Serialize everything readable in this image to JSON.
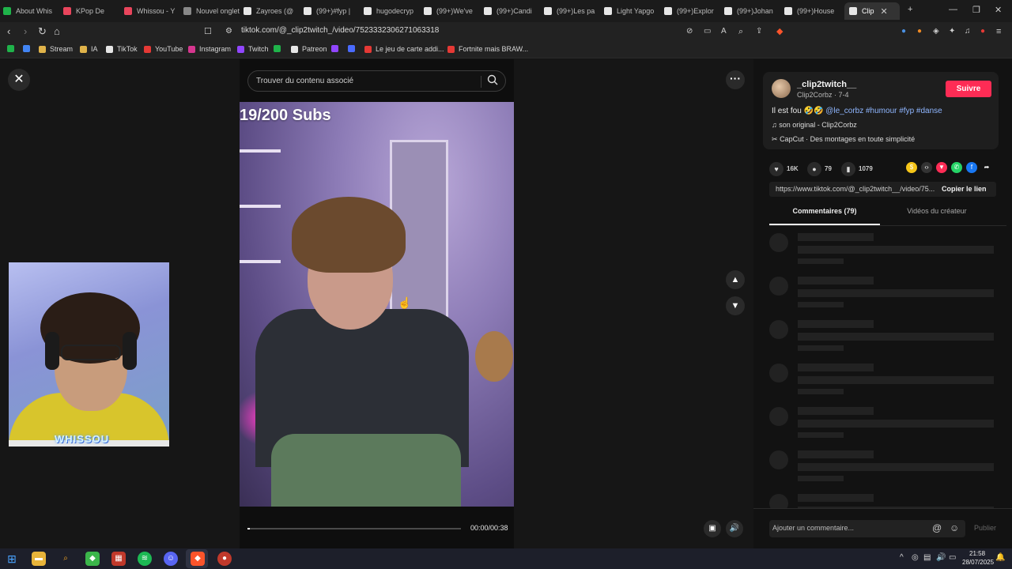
{
  "browser": {
    "tabs": [
      {
        "label": "About Whis",
        "color": "#1fb34a"
      },
      {
        "label": "KPop De",
        "color": "#e9455c"
      },
      {
        "label": "Whissou - Y",
        "color": "#e9455c"
      },
      {
        "label": "Nouvel onglet",
        "color": "#888888"
      },
      {
        "label": "Zayroes (@",
        "color": "#e6e6e6"
      },
      {
        "label": "(99+)#fyp |",
        "color": "#e6e6e6"
      },
      {
        "label": "hugodecryp",
        "color": "#e6e6e6"
      },
      {
        "label": "(99+)We've",
        "color": "#e6e6e6"
      },
      {
        "label": "(99+)Candi",
        "color": "#e6e6e6"
      },
      {
        "label": "(99+)Les pa",
        "color": "#e6e6e6"
      },
      {
        "label": "Light Yapgo",
        "color": "#e6e6e6"
      },
      {
        "label": "(99+)Explor",
        "color": "#e6e6e6"
      },
      {
        "label": "(99+)Johan",
        "color": "#e6e6e6"
      },
      {
        "label": "(99+)House",
        "color": "#e6e6e6"
      },
      {
        "label": "Clip",
        "color": "#e6e6e6"
      }
    ],
    "url": "tiktok.com/@_clip2twitch_/video/7523332306271063318",
    "bookmarks": [
      {
        "label": "",
        "color": "#1fb34a"
      },
      {
        "label": "",
        "color": "#4285f4"
      },
      {
        "label": "Stream",
        "color": "#e0b34a"
      },
      {
        "label": "IA",
        "color": "#e0b34a"
      },
      {
        "label": "TikTok",
        "color": "#e6e6e6"
      },
      {
        "label": "YouTube",
        "color": "#e53935"
      },
      {
        "label": "Instagram",
        "color": "#d6368f"
      },
      {
        "label": "Twitch",
        "color": "#9146ff"
      },
      {
        "label": "",
        "color": "#1fb34a"
      },
      {
        "label": "Patreon",
        "color": "#e6e6e6"
      },
      {
        "label": "",
        "color": "#9146ff"
      },
      {
        "label": "",
        "color": "#4a6bff"
      },
      {
        "label": "Le jeu de carte addi...",
        "color": "#e53935"
      },
      {
        "label": "Fortnite mais BRAW...",
        "color": "#e53935"
      }
    ]
  },
  "search": {
    "placeholder": "Trouver du contenu associé"
  },
  "video": {
    "overlay_text": "19/200 Subs",
    "time": "00:00/00:38",
    "progress": 0.01
  },
  "webcam": {
    "badge": "WHISSOU"
  },
  "creator": {
    "username": "_clip2twitch__",
    "subline": "Clip2Corbz · 7-4",
    "follow_label": "Suivre",
    "desc_prefix": "Il est fou 🤣🤣",
    "desc_tags": "@le_corbz #humour #fyp #danse",
    "sound": "son original - Clip2Corbz",
    "capcut": "CapCut · Des montages en toute simplicité"
  },
  "stats": {
    "likes": "16K",
    "comments": "79",
    "saves": "1079"
  },
  "link": {
    "url": "https://www.tiktok.com/@_clip2twitch__/video/75...",
    "copy_label": "Copier le lien"
  },
  "tabs": {
    "comments": "Commentaires (79)",
    "creator_videos": "Vidéos du créateur"
  },
  "comment_box": {
    "placeholder": "Ajouter un commentaire...",
    "publish": "Publier"
  },
  "clock": {
    "time": "21:58",
    "date": "28/07/2025"
  },
  "colors": {
    "follow": "#fe2c55",
    "tag": "#8fb6ff"
  }
}
